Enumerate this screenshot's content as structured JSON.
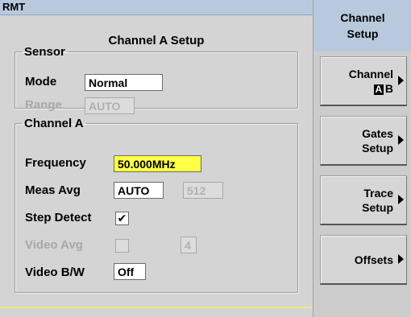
{
  "status": {
    "text": "RMT"
  },
  "screen_title": "Channel A Setup",
  "sensor": {
    "legend": "Sensor",
    "mode_label": "Mode",
    "mode_value": "Normal",
    "range_label": "Range",
    "range_value": "AUTO"
  },
  "channel": {
    "legend": "Channel A",
    "frequency_label": "Frequency",
    "frequency_value": "50.000MHz",
    "meas_avg_label": "Meas Avg",
    "meas_avg_value": "AUTO",
    "meas_avg_count": "512",
    "step_detect_label": "Step Detect",
    "step_detect_checked": true,
    "step_detect_mark": "✔",
    "video_avg_label": "Video Avg",
    "video_avg_value": "4",
    "video_bw_label": "Video B/W",
    "video_bw_value": "Off"
  },
  "softkeys": {
    "title_line1": "Channel",
    "title_line2": "Setup",
    "channel_label": "Channel",
    "channel_a": "A",
    "channel_b": "B",
    "gates_line1": "Gates",
    "gates_line2": "Setup",
    "trace_line1": "Trace",
    "trace_line2": "Setup",
    "offsets": "Offsets"
  },
  "colors": {
    "highlight": "#ffff46",
    "title_bar": "#b9c9dd",
    "panel": "#d4d4d4"
  }
}
